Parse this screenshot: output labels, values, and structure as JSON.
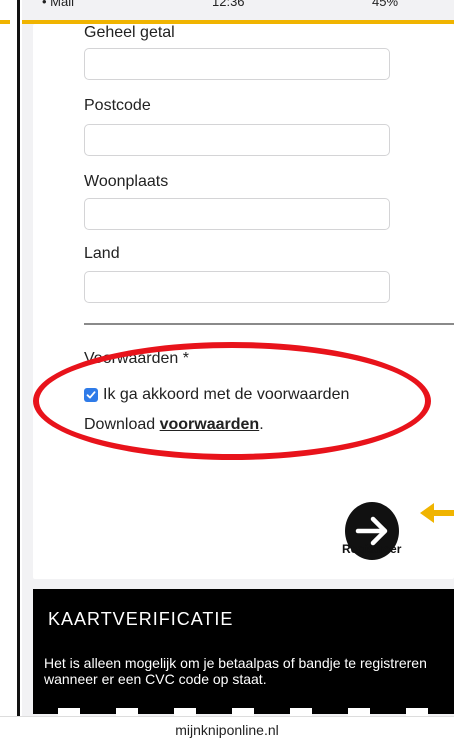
{
  "status_bar": {
    "carrier": "• Mail",
    "time": "12:36",
    "battery": "45%"
  },
  "form": {
    "fields": [
      {
        "label": "Geheel getal",
        "value": ""
      },
      {
        "label": "Postcode",
        "value": ""
      },
      {
        "label": "Woonplaats",
        "value": ""
      },
      {
        "label": "Land",
        "value": ""
      }
    ],
    "terms_heading": "Voorwaarden *",
    "checkbox_label": "Ik ga akkoord met de voorwaarden",
    "checkbox_checked": true,
    "download_prefix": "Download ",
    "download_link": "voorwaarden",
    "download_suffix": ".",
    "submit_label": "Registreer"
  },
  "info": {
    "title": "KAARTVERIFICATIE",
    "text": "Het is alleen mogelijk om je betaalpas of bandje te registreren wanneer er een CVC code op staat."
  },
  "footer": {
    "url": "mijnkniponline.nl"
  },
  "colors": {
    "annotation_ellipse": "#e8131b",
    "annotation_arrow": "#f0b400",
    "checkbox": "#2f7be8"
  },
  "icons": {
    "submit": "arrow-right-icon",
    "annotation": "arrow-left-icon"
  }
}
